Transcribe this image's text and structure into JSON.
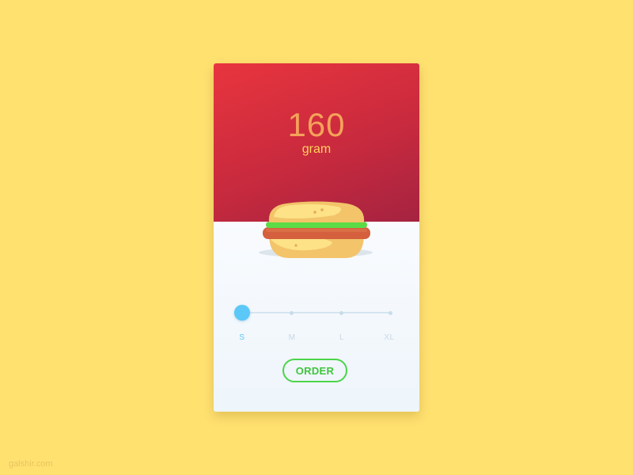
{
  "product": {
    "weight_value": "160",
    "weight_unit": "gram",
    "image_icon": "burger-illustration"
  },
  "size_selector": {
    "options": [
      "S",
      "M",
      "L",
      "XL"
    ],
    "selected": "S",
    "selected_index": 0
  },
  "actions": {
    "order_label": "ORDER"
  },
  "footer": {
    "watermark": "galshir.com"
  },
  "colors": {
    "background": "#FFE170",
    "header_gradient_start": "#E8353E",
    "header_gradient_end": "#A52340",
    "accent_blue": "#5BC8F7",
    "order_green": "#4CD44A"
  }
}
